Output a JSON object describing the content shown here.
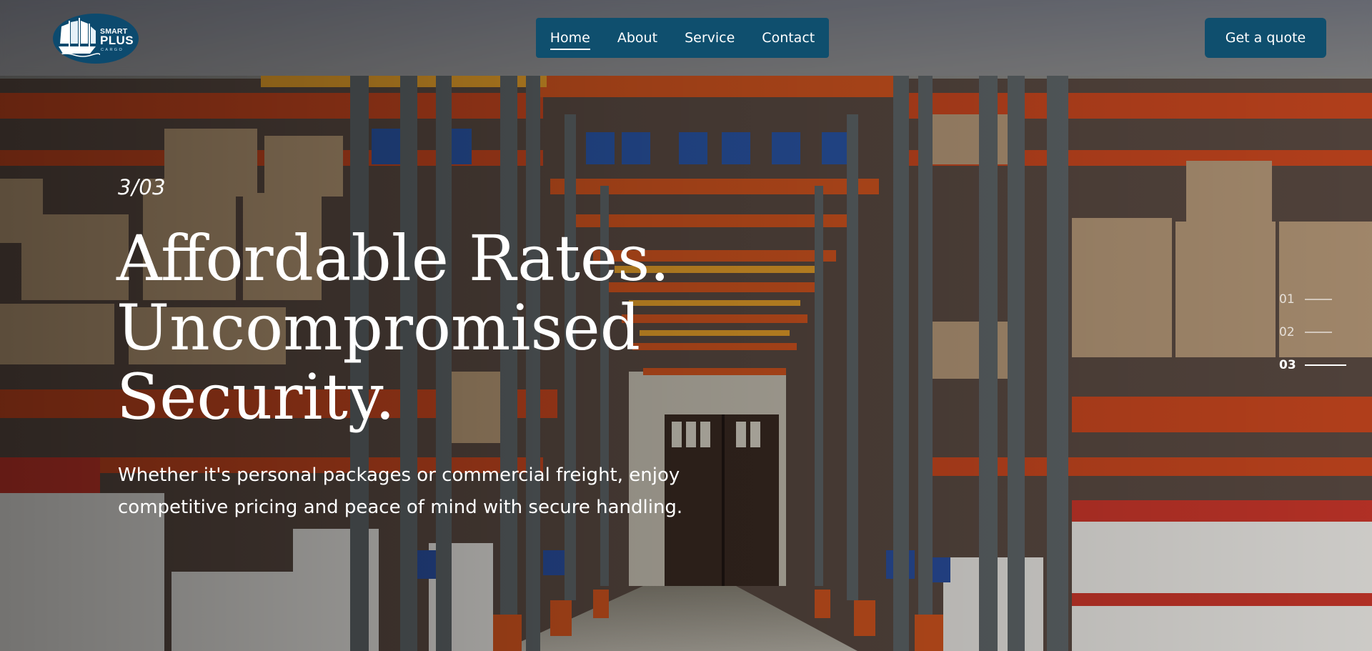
{
  "brand": {
    "logo_alt": "Smart Plus Cargo",
    "logo_line1": "SMART",
    "logo_line2": "PLUS",
    "logo_line3": "CARGO"
  },
  "nav": {
    "items": [
      {
        "label": "Home",
        "active": true
      },
      {
        "label": "About",
        "active": false
      },
      {
        "label": "Service",
        "active": false
      },
      {
        "label": "Contact",
        "active": false
      }
    ]
  },
  "cta": {
    "label": "Get a quote"
  },
  "hero": {
    "slide_counter": "3/03",
    "headline_lines": [
      "Affordable Rates.",
      "Uncompromised",
      "Security."
    ],
    "subtext": "Whether it's personal packages or commercial freight, enjoy competitive pricing and peace of mind with secure handling."
  },
  "slider": {
    "items": [
      "01",
      "02",
      "03"
    ],
    "active_index": 2
  },
  "colors": {
    "brand_blue": "#0f4f6e",
    "text": "#ffffff"
  },
  "icons": {
    "logo": "ship-icon"
  }
}
